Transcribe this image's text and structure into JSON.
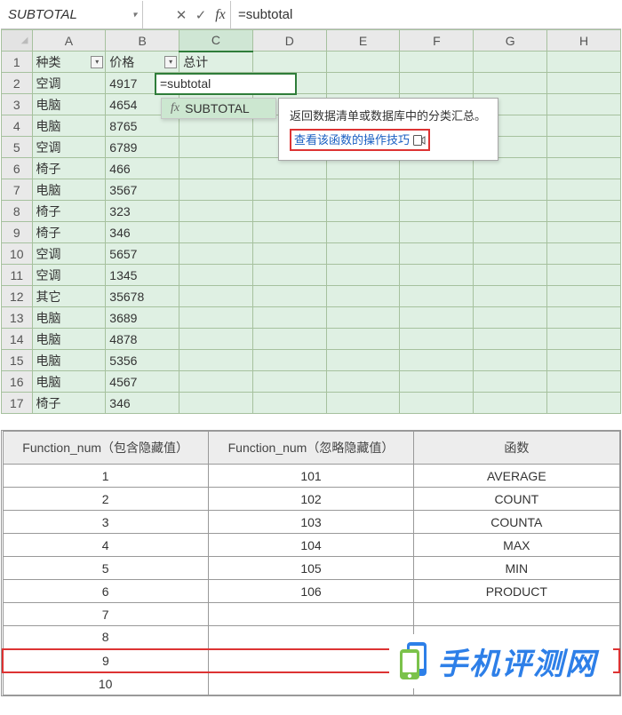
{
  "formula_bar": {
    "name_box": "SUBTOTAL",
    "cancel": "✕",
    "accept": "✓",
    "fx": "fx",
    "formula": "=subtotal"
  },
  "columns": [
    "A",
    "B",
    "C",
    "D",
    "E",
    "F",
    "G",
    "H"
  ],
  "selected_col": "C",
  "headers": {
    "A": "种类",
    "B": "价格",
    "C": "总计"
  },
  "rows": [
    {
      "n": 1
    },
    {
      "n": 2,
      "A": "空调",
      "B": "4917"
    },
    {
      "n": 3,
      "A": "电脑",
      "B": "4654"
    },
    {
      "n": 4,
      "A": "电脑",
      "B": "8765"
    },
    {
      "n": 5,
      "A": "空调",
      "B": "6789"
    },
    {
      "n": 6,
      "A": "椅子",
      "B": "466"
    },
    {
      "n": 7,
      "A": "电脑",
      "B": "3567"
    },
    {
      "n": 8,
      "A": "椅子",
      "B": "323"
    },
    {
      "n": 9,
      "A": "椅子",
      "B": "346"
    },
    {
      "n": 10,
      "A": "空调",
      "B": "5657"
    },
    {
      "n": 11,
      "A": "空调",
      "B": "1345"
    },
    {
      "n": 12,
      "A": "其它",
      "B": "35678"
    },
    {
      "n": 13,
      "A": "电脑",
      "B": "3689"
    },
    {
      "n": 14,
      "A": "电脑",
      "B": "4878"
    },
    {
      "n": 15,
      "A": "电脑",
      "B": "5356"
    },
    {
      "n": 16,
      "A": "电脑",
      "B": "4567"
    },
    {
      "n": 17,
      "A": "椅子",
      "B": "346"
    }
  ],
  "active_cell": {
    "row": 2,
    "col": "C",
    "value": "=subtotal"
  },
  "autocomplete": {
    "label": "SUBTOTAL",
    "fx": "fx"
  },
  "tooltip": {
    "desc": "返回数据清单或数据库中的分类汇总。",
    "link": "查看该函数的操作技巧"
  },
  "ref_table": {
    "headers": [
      "Function_num（包含隐藏值）",
      "Function_num（忽略隐藏值）",
      "函数"
    ],
    "rows": [
      [
        "1",
        "101",
        "AVERAGE"
      ],
      [
        "2",
        "102",
        "COUNT"
      ],
      [
        "3",
        "103",
        "COUNTA"
      ],
      [
        "4",
        "104",
        "MAX"
      ],
      [
        "5",
        "105",
        "MIN"
      ],
      [
        "6",
        "106",
        "PRODUCT"
      ],
      [
        "7",
        "",
        ""
      ],
      [
        "8",
        "",
        ""
      ],
      [
        "9",
        "",
        ""
      ],
      [
        "10",
        "",
        ""
      ]
    ],
    "highlight_row_index": 8
  },
  "watermark": {
    "text": "手机评测网"
  }
}
